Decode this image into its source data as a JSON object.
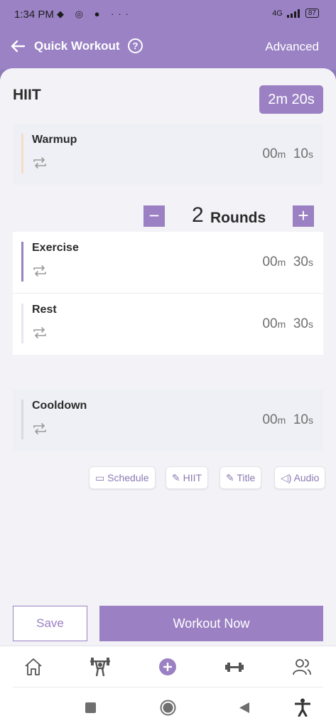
{
  "status": {
    "time": "1:34 PM",
    "icons": "◆ ◎ ● ···",
    "network": "4G",
    "battery": "87"
  },
  "header": {
    "title": "Quick Workout",
    "help_label": "?",
    "advanced_label": "Advanced"
  },
  "workout": {
    "name": "HIIT",
    "total_time": "2m 20s"
  },
  "warmup": {
    "label": "Warmup",
    "minutes": "00",
    "seconds": "10",
    "accent": "#f7dcc6"
  },
  "rounds": {
    "count": "2",
    "label": "Rounds",
    "minus": "−",
    "plus": "+"
  },
  "exercise": {
    "label": "Exercise",
    "minutes": "00",
    "seconds": "30",
    "accent": "#9b80c3"
  },
  "rest": {
    "label": "Rest",
    "minutes": "00",
    "seconds": "30",
    "accent": "#e6e6ee"
  },
  "cooldown": {
    "label": "Cooldown",
    "minutes": "00",
    "seconds": "10",
    "accent": "#d9d9e2"
  },
  "units": {
    "min": "m",
    "sec": "s"
  },
  "chips": {
    "schedule": "Schedule",
    "hiit": "HIIT",
    "title": "Title",
    "audio": "Audio"
  },
  "actions": {
    "save": "Save",
    "workout_now": "Workout Now"
  },
  "tabs": [
    "home-icon",
    "weightlifter-icon",
    "add-circle-icon",
    "dumbbell-icon",
    "people-icon"
  ],
  "colors": {
    "accent": "#9b80c3",
    "header": "#9a82c4",
    "background": "#f3f3f7"
  }
}
